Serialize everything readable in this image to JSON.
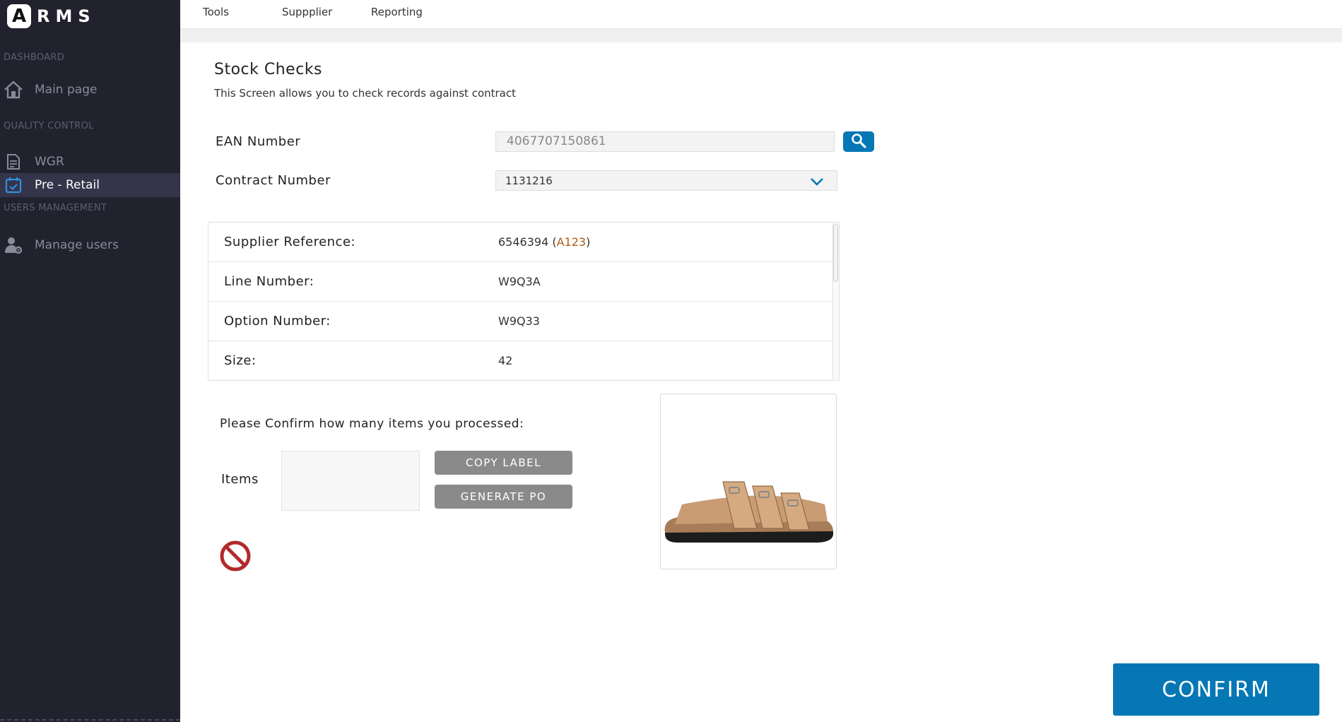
{
  "app": {
    "logo_letter": "A",
    "logo_text": "RMS"
  },
  "sidebar": {
    "sections": [
      {
        "label": "DASHBOARD"
      },
      {
        "label": "QUALITY CONTROL"
      },
      {
        "label": "USERS MANAGEMENT"
      }
    ],
    "items": [
      {
        "label": "Main page",
        "icon": "home-icon"
      },
      {
        "label": "WGR",
        "icon": "document-icon"
      },
      {
        "label": "Pre - Retail",
        "icon": "calendar-check-icon",
        "active": true
      },
      {
        "label": "Manage users",
        "icon": "user-gear-icon"
      }
    ]
  },
  "topbar": {
    "tabs": [
      {
        "label": "Tools"
      },
      {
        "label": "Suppplier"
      },
      {
        "label": "Reporting"
      }
    ]
  },
  "main": {
    "title": "Stock Checks",
    "subtitle": "This Screen allows you to check records against contract",
    "ean": {
      "label": "EAN Number",
      "value": "4067707150861"
    },
    "contract": {
      "label": "Contract Number",
      "value": "1131216"
    },
    "details": [
      {
        "label": "Supplier Reference:",
        "value": "6546394",
        "code": "A123"
      },
      {
        "label": "Line Number:",
        "value": "W9Q3A"
      },
      {
        "label": "Option Number:",
        "value": "W9Q33"
      },
      {
        "label": "Size:",
        "value": "42"
      }
    ],
    "question": "Please Confirm how many items you processed:",
    "items_label": "Items",
    "items_value": "",
    "copy_label_button": "COPY LABEL",
    "generate_po_button": "GENERATE PO",
    "confirm_button": "CONFIRM"
  },
  "colors": {
    "sidebar_bg": "#22222f",
    "accent": "#0677b5",
    "grey_button": "#8a8a8a",
    "prohibited": "#b22a2a"
  }
}
